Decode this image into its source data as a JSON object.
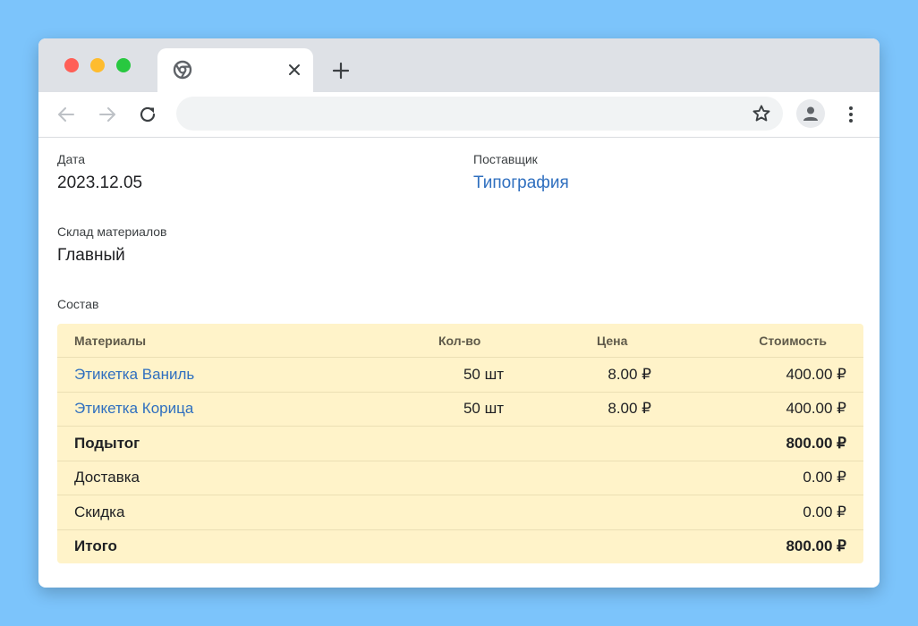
{
  "browser": {
    "tab_title": "",
    "address": ""
  },
  "form": {
    "date_label": "Дата",
    "date_value": "2023.12.05",
    "supplier_label": "Поставщик",
    "supplier_value": "Типография",
    "warehouse_label": "Склад материалов",
    "warehouse_value": "Главный",
    "composition_label": "Состав"
  },
  "table": {
    "headers": {
      "material": "Материалы",
      "qty": "Кол-во",
      "price": "Цена",
      "cost": "Стоимость"
    },
    "rows": [
      {
        "material": "Этикетка Ваниль",
        "qty": "50 шт",
        "price": "8.00 ₽",
        "cost": "400.00 ₽"
      },
      {
        "material": "Этикетка Корица",
        "qty": "50 шт",
        "price": "8.00 ₽",
        "cost": "400.00 ₽"
      }
    ],
    "subtotal": {
      "label": "Подытог",
      "value": "800.00 ₽"
    },
    "delivery": {
      "label": "Доставка",
      "value": "0.00 ₽"
    },
    "discount": {
      "label": "Скидка",
      "value": "0.00 ₽"
    },
    "total": {
      "label": "Итого",
      "value": "800.00 ₽"
    }
  },
  "colors": {
    "background": "#7cc4fb",
    "link": "#2f6fbf",
    "table_bg": "#fff3c9"
  }
}
